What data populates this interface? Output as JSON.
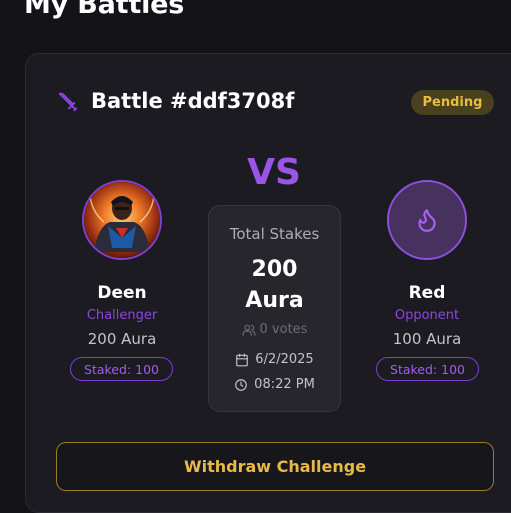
{
  "page": {
    "title": "My Battles"
  },
  "battle": {
    "title": "Battle #ddf3708f",
    "status": "Pending",
    "vs_label": "VS"
  },
  "challenger": {
    "name": "Deen",
    "role": "Challenger",
    "aura": "200 Aura",
    "staked": "Staked: 100"
  },
  "opponent": {
    "name": "Red",
    "role": "Opponent",
    "aura": "100 Aura",
    "staked": "Staked: 100",
    "avatar_icon": "flame-icon"
  },
  "stakes": {
    "label": "Total Stakes",
    "amount_line1": "200",
    "amount_line2": "Aura",
    "votes": "0 votes",
    "date": "6/2/2025",
    "time": "08:22 PM"
  },
  "actions": {
    "withdraw_label": "Withdraw Challenge"
  },
  "colors": {
    "accent_purple": "#9b55e6",
    "pending_badge_bg": "#48401f",
    "pending_badge_text": "#e8be3b",
    "withdraw_gold": "#e6b94a"
  }
}
